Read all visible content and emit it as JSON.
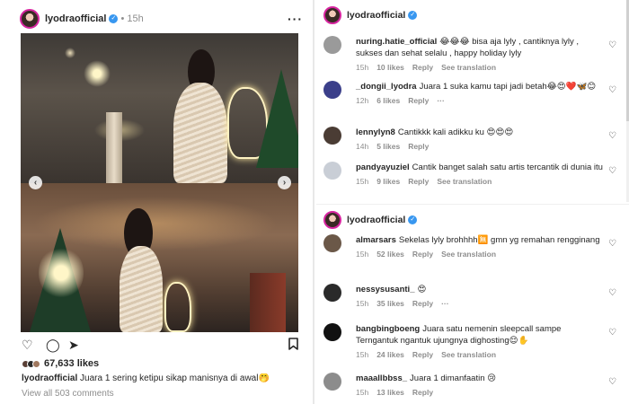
{
  "post": {
    "username": "lyodraofficial",
    "verified_mark": "✓",
    "dot": "•",
    "time": "15h",
    "more": "···",
    "likes": "67,633 likes",
    "caption_user": "lyodraofficial",
    "caption_text": "Juara 1 sering ketipu sikap manisnya di awal🤭",
    "view_all": "View all 503 comments",
    "icons": {
      "like": "♡",
      "comment": "◯",
      "share": "➤",
      "save": "⊓",
      "prev": "‹",
      "next": "›"
    }
  },
  "panel1": {
    "username": "lyodraofficial",
    "verified_mark": "✓",
    "comments": [
      {
        "user": "nuring.hatie_official",
        "text": "😂😂😂 bisa aja lyly , cantiknya lyly , sukses dan sehat selalu , happy holiday lyly",
        "time": "15h",
        "likes": "10 likes",
        "reply": "Reply",
        "translation": "See translation",
        "avatar_color": "#9a9a9a"
      },
      {
        "user": "_dongii_lyodra",
        "text": "Juara 1 suka kamu tapi jadi betah😂😍❤️🦋😊",
        "time": "12h",
        "likes": "6 likes",
        "reply": "Reply",
        "translation": "···",
        "avatar_color": "#3b3f8a"
      },
      {
        "user": "lennylyn8",
        "text": "Cantikkk kali adikku ku 😍😍😍",
        "time": "14h",
        "likes": "5 likes",
        "reply": "Reply",
        "translation": "",
        "avatar_color": "#4a3c34"
      },
      {
        "user": "pandyayuziel",
        "text": "Cantik banget salah satu artis tercantik di dunia itu",
        "time": "15h",
        "likes": "9 likes",
        "reply": "Reply",
        "translation": "See translation",
        "avatar_color": "#c9ced6"
      }
    ]
  },
  "panel2": {
    "username": "lyodraofficial",
    "verified_mark": "✓",
    "comments": [
      {
        "user": "almarsars",
        "text": "Sekelas lyly brohhhh🈚 gmn yg remahan rengginang",
        "time": "15h",
        "likes": "52 likes",
        "reply": "Reply",
        "translation": "See translation",
        "avatar_color": "#6b5848"
      },
      {
        "user": "nessysusanti_",
        "text": "😍",
        "time": "15h",
        "likes": "35 likes",
        "reply": "Reply",
        "translation": "···",
        "avatar_color": "#2a2a2a"
      },
      {
        "user": "bangbingboeng",
        "text": "Juara satu nemenin sleepcall sampe Terngantuk ngantuk ujungnya dighosting😌✋",
        "time": "15h",
        "likes": "24 likes",
        "reply": "Reply",
        "translation": "See translation",
        "avatar_color": "#111111"
      },
      {
        "user": "maaallbbss_",
        "text": "Juara 1 dimanfaatin 😢",
        "time": "15h",
        "likes": "13 likes",
        "reply": "Reply",
        "translation": "",
        "avatar_color": "#8c8c8c"
      }
    ]
  },
  "heart": "♡"
}
